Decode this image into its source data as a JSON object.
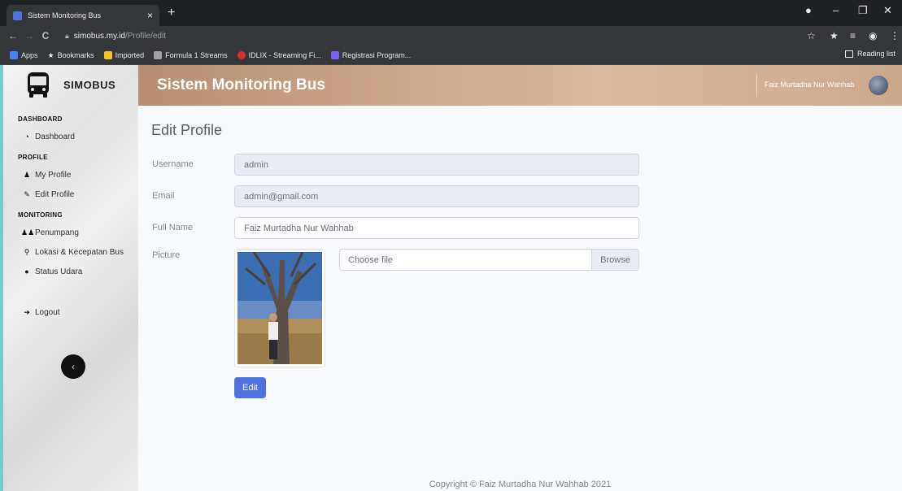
{
  "browser": {
    "tab_title": "Sistem Monitoring Bus",
    "tab_close": "×",
    "new_tab": "+",
    "url_host": "simobus.my.id",
    "url_path": "/Profile/edit",
    "bookmarks": [
      {
        "label": "Apps",
        "icon_color": "#4285f4"
      },
      {
        "label": "Bookmarks",
        "icon_color": "#e8eaed"
      },
      {
        "label": "Imported",
        "icon_color": "#f6c026"
      },
      {
        "label": "Formula 1 Streams",
        "icon_color": "#a0a0a0"
      },
      {
        "label": "IDLIX - Streaming Fi...",
        "icon_color": "#d93025"
      },
      {
        "label": "Registrasi Program...",
        "icon_color": "#7b61ff"
      }
    ],
    "reading_list": "Reading list"
  },
  "sidebar": {
    "brand": "SIMOBUS",
    "sections": [
      {
        "heading": "DASHBOARD",
        "items": [
          {
            "label": "Dashboard",
            "icon": "tachometer-icon"
          }
        ]
      },
      {
        "heading": "PROFILE",
        "items": [
          {
            "label": "My Profile",
            "icon": "user-icon"
          },
          {
            "label": "Edit Profile",
            "icon": "user-edit-icon"
          }
        ]
      },
      {
        "heading": "MONITORING",
        "items": [
          {
            "label": "Penumpang",
            "icon": "users-icon"
          },
          {
            "label": "Lokasi & Kecepatan Bus",
            "icon": "map-marker-icon"
          },
          {
            "label": "Status Udara",
            "icon": "fire-icon"
          }
        ]
      }
    ],
    "logout": "Logout",
    "toggle": "‹"
  },
  "topbar": {
    "title": "Sistem Monitoring Bus",
    "user_name": "Faiz Murtadha Nur Wahhab"
  },
  "form": {
    "title": "Edit Profile",
    "username_label": "Username",
    "username_value": "admin",
    "email_label": "Email",
    "email_value": "admin@gmail.com",
    "fullname_label": "Full Name",
    "fullname_value": "Faiz Murtadha Nur Wahhab",
    "picture_label": "Picture",
    "file_placeholder": "Choose file",
    "browse_label": "Browse",
    "submit_label": "Edit"
  },
  "footer": "Copyright © Faiz Murtadha Nur Wahhab 2021",
  "colors": {
    "primary": "#4e73df",
    "sidebar_accent": "#7ec8c8"
  }
}
